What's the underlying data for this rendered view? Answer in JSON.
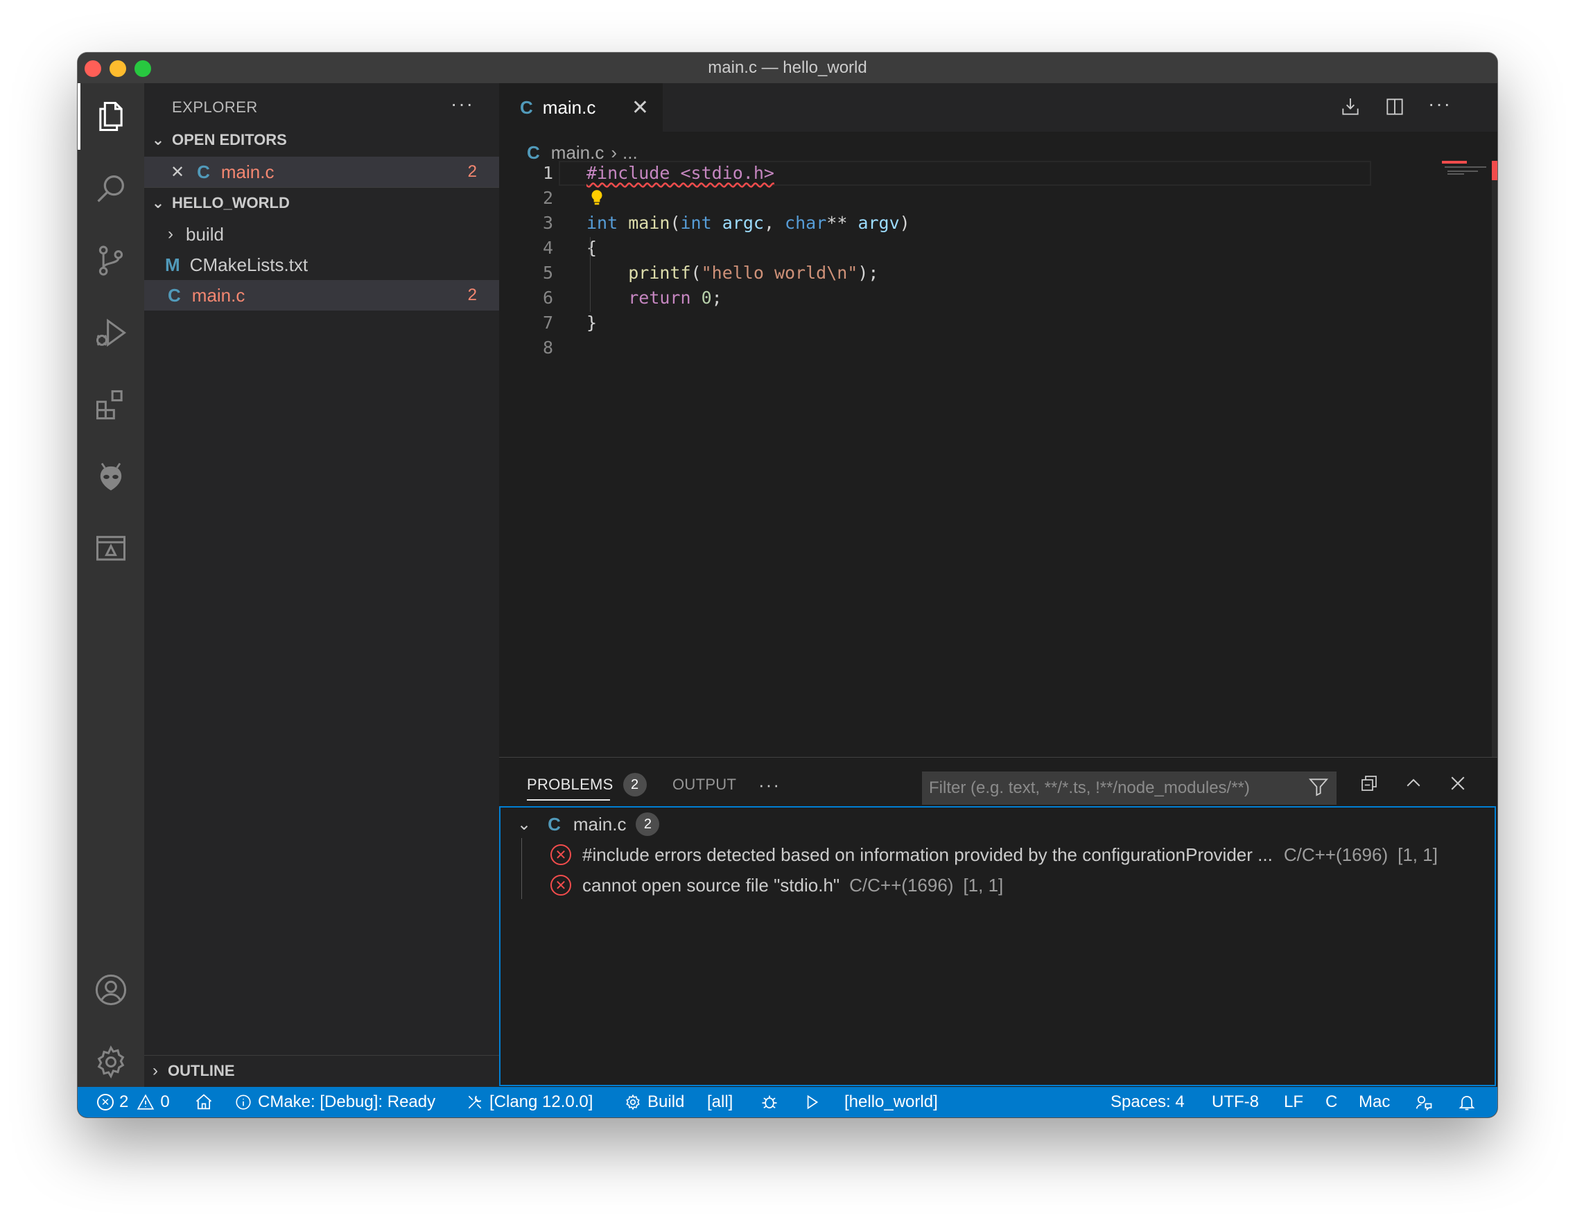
{
  "window": {
    "title": "main.c — hello_world",
    "traffic_lights": {
      "close": "#ff5f57",
      "minimize": "#febc2e",
      "maximize": "#28c840"
    }
  },
  "activity_bar": {
    "items": [
      "files-icon",
      "search-icon",
      "source-control-icon",
      "run-debug-icon",
      "extensions-icon",
      "alien-icon",
      "remote-explorer-icon"
    ],
    "bottom_items": [
      "account-icon",
      "gear-icon"
    ]
  },
  "sidebar": {
    "title": "EXPLORER",
    "more": "···",
    "open_editors": {
      "label": "OPEN EDITORS",
      "items": [
        {
          "close": "✕",
          "lang": "C",
          "name": "main.c",
          "problems": "2"
        }
      ]
    },
    "folder": {
      "label": "HELLO_WORLD",
      "items": [
        {
          "type": "folder",
          "name": "build"
        },
        {
          "type": "file",
          "lang": "M",
          "name": "CMakeLists.txt"
        },
        {
          "type": "file",
          "lang": "C",
          "name": "main.c",
          "problems": "2"
        }
      ]
    },
    "outline": {
      "label": "OUTLINE"
    }
  },
  "editor": {
    "tab": {
      "lang": "C",
      "label": "main.c",
      "close": "✕"
    },
    "breadcrumb": {
      "lang": "C",
      "file": "main.c",
      "sep": "›",
      "more": "..."
    },
    "lines": [
      "1",
      "2",
      "3",
      "4",
      "5",
      "6",
      "7",
      "8"
    ],
    "code": {
      "l1_include": "#include <stdio.h>",
      "l3_int": "int",
      "l3_main": "main",
      "l3_open": "(",
      "l3_int2": "int",
      "l3_argc": "argc",
      "l3_comma": ", ",
      "l3_char": "char",
      "l3_stars": "**",
      "l3_argv": "argv",
      "l3_close": ")",
      "l4": "{",
      "l5_printf": "printf",
      "l5_open": "(",
      "l5_str": "\"hello world\\n\"",
      "l5_close": ");",
      "l6_return": "return",
      "l6_num": "0",
      "l6_semi": ";",
      "l7": "}"
    }
  },
  "panel": {
    "tabs": [
      {
        "label": "PROBLEMS",
        "count": "2"
      },
      {
        "label": "OUTPUT"
      }
    ],
    "more": "···",
    "filter_placeholder": "Filter (e.g. text, **/*.ts, !**/node_modules/**)",
    "file": {
      "lang": "C",
      "name": "main.c",
      "count": "2"
    },
    "problems": [
      {
        "message": "#include errors detected based on information provided by the configurationProvider ...",
        "source": "C/C++(1696)",
        "position": "[1, 1]"
      },
      {
        "message": "cannot open source file \"stdio.h\"",
        "source": "C/C++(1696)",
        "position": "[1, 1]"
      }
    ]
  },
  "statusbar": {
    "errors": "2",
    "warnings": "0",
    "cmake": "CMake: [Debug]: Ready",
    "kit": "[Clang 12.0.0]",
    "build": "Build",
    "target": "[all]",
    "launch_target": "[hello_world]",
    "spaces": "Spaces: 4",
    "encoding": "UTF-8",
    "eol": "LF",
    "language": "C",
    "platform": "Mac"
  },
  "colors": {
    "accent": "#007acc",
    "error": "#f14c4c",
    "error_text": "#f48771",
    "c_icon": "#519aba"
  }
}
